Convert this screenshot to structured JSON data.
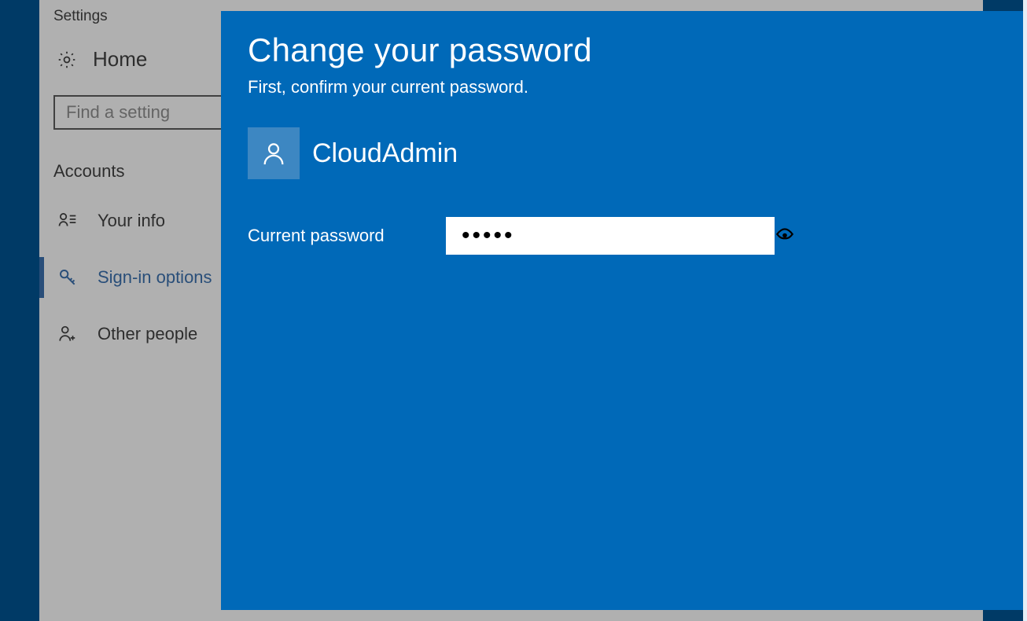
{
  "settings": {
    "window_title": "Settings",
    "home_label": "Home",
    "search_placeholder": "Find a setting",
    "section_label": "Accounts",
    "nav": [
      {
        "id": "your-info",
        "label": "Your info",
        "selected": false
      },
      {
        "id": "sign-in",
        "label": "Sign-in options",
        "selected": true
      },
      {
        "id": "other-people",
        "label": "Other people",
        "selected": false
      }
    ]
  },
  "panel": {
    "title": "Change your password",
    "subtitle": "First, confirm your current password.",
    "user_name": "CloudAdmin",
    "field_label": "Current password",
    "password_value": "•••••",
    "reveal_icon": "eye-icon"
  }
}
